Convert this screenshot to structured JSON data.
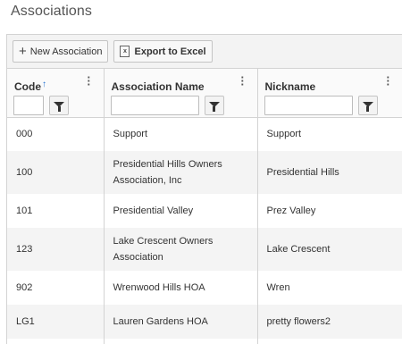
{
  "page": {
    "title": "Associations"
  },
  "toolbar": {
    "new_label": "New Association",
    "export_label": "Export to Excel"
  },
  "columns": [
    {
      "label": "Code",
      "sort": "ascending"
    },
    {
      "label": "Association Name"
    },
    {
      "label": "Nickname"
    }
  ],
  "rows": [
    {
      "code": "000",
      "name": "Support",
      "nickname": "Support"
    },
    {
      "code": "100",
      "name": "Presidential Hills Owners Association, Inc",
      "nickname": "Presidential Hills"
    },
    {
      "code": "101",
      "name": "Presidential Valley",
      "nickname": "Prez Valley"
    },
    {
      "code": "123",
      "name": "Lake Crescent Owners Association",
      "nickname": "Lake Crescent"
    },
    {
      "code": "902",
      "name": "Wrenwood Hills HOA",
      "nickname": "Wren"
    },
    {
      "code": "LG1",
      "name": "Lauren Gardens HOA",
      "nickname": "pretty flowers2"
    }
  ],
  "colors": {
    "sort_arrow": "#1f6fd0",
    "row_alt": "#f4f4f4",
    "toolbar_bg": "#f3f3f3"
  },
  "icons": {
    "new": "plus-icon",
    "export": "excel-icon",
    "filter": "filter-icon",
    "menu": "kebab-menu-icon"
  }
}
